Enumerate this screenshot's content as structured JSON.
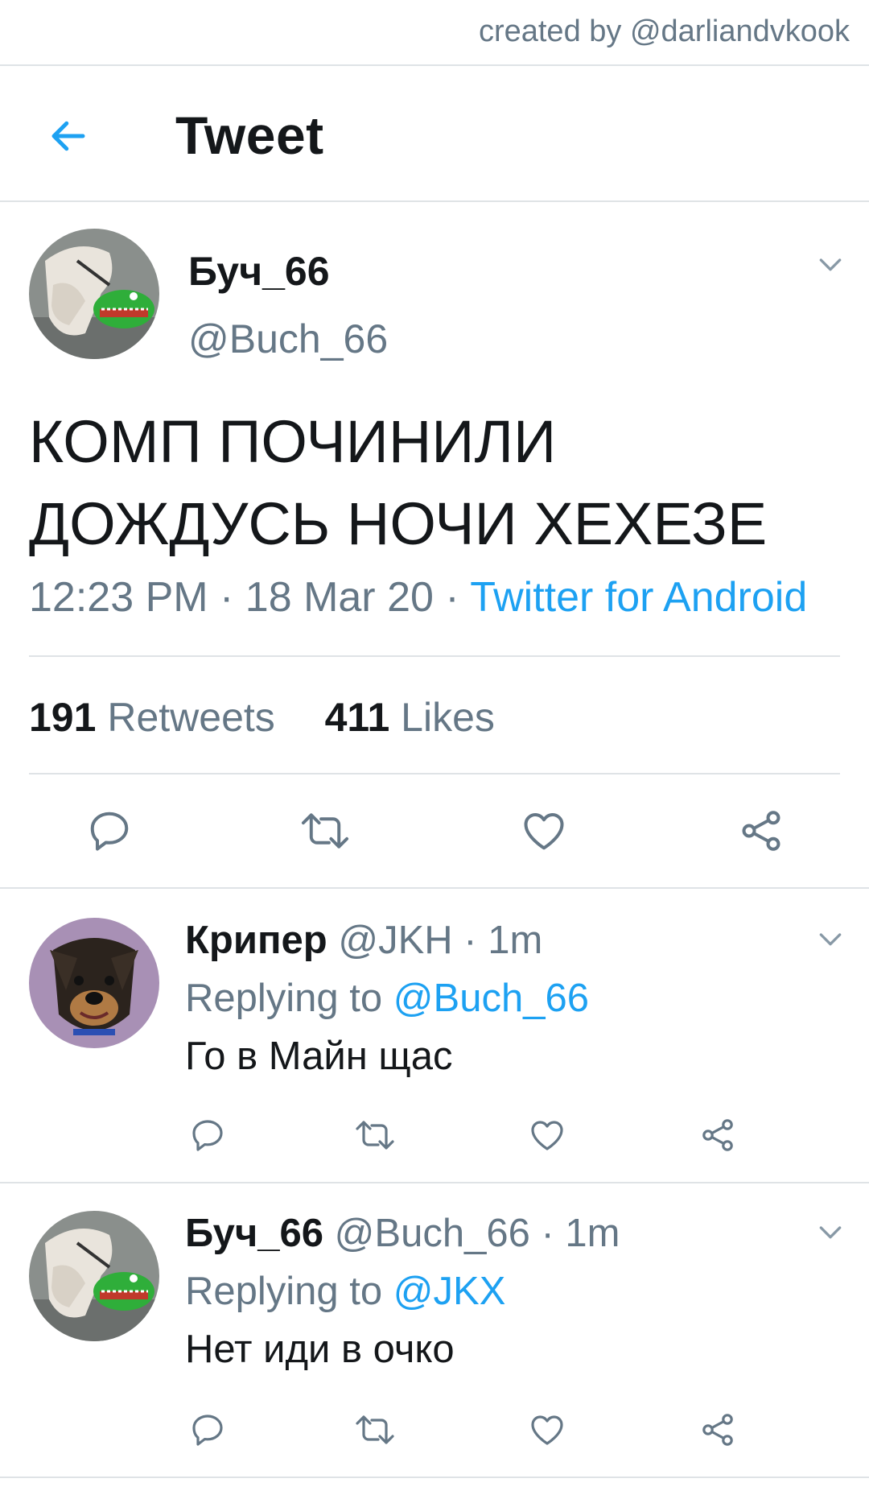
{
  "credit": "created by @darliandvkook",
  "header": {
    "title": "Tweet",
    "back_icon": "arrow-left-icon",
    "accent": "#1da1f2"
  },
  "main_tweet": {
    "name": "Буч_66",
    "handle": "@Buch_66",
    "text_line1": "КОМП ПОЧИНИЛИ",
    "text_line2": "ДОЖДУСЬ НОЧИ ХЕХЕЗЕ",
    "time": "12:23 PM · 18 Mar 20 · ",
    "source": "Twitter for Android",
    "retweets_count": "191",
    "retweets_label": "Retweets",
    "likes_count": "411",
    "likes_label": "Likes"
  },
  "replies": [
    {
      "name": "Крипер",
      "handle_time": "@JKH · 1m",
      "replying_prefix": "Replying to ",
      "replying_to": "@Buch_66",
      "text": "Го в Майн щас"
    },
    {
      "name": "Буч_66",
      "handle_time": "@Buch_66 · 1m",
      "replying_prefix": "Replying to ",
      "replying_to": "@JKX",
      "text": "Нет иди в очко"
    }
  ],
  "colors": {
    "text": "#14171a",
    "secondary": "#657786",
    "link": "#1da1f2",
    "divider": "#dfe3e6"
  }
}
